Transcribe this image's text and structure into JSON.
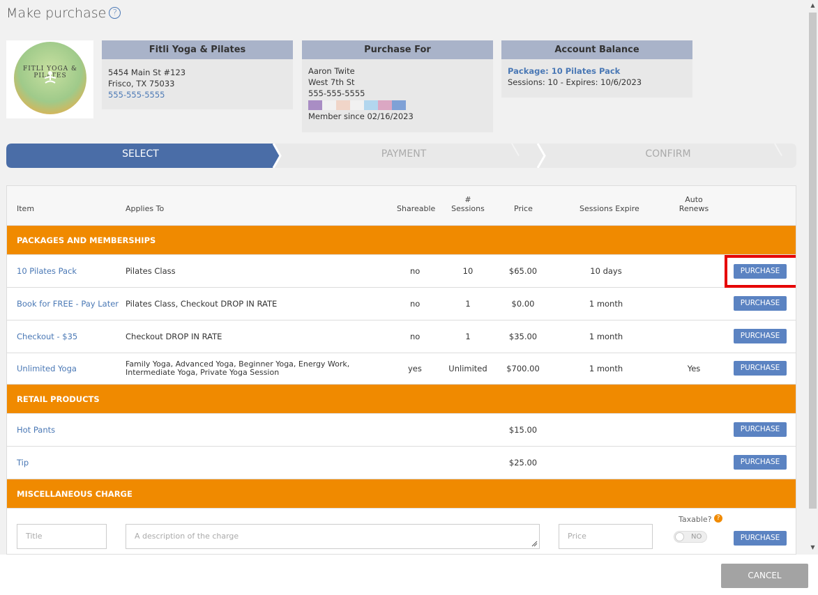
{
  "header": {
    "title": "Make purchase"
  },
  "studio": {
    "name": "Fitli Yoga & Pilates",
    "address1": "5454 Main St #123",
    "address2": "Frisco, TX 75033",
    "phone": "555-555-5555",
    "logo_text": "FITLI YOGA & PILATES"
  },
  "purchase_for": {
    "heading": "Purchase For",
    "name": "Aaron Twite",
    "street": "West 7th St",
    "phone": "555-555-5555",
    "member_since": "Member since 02/16/2023",
    "swatches": [
      "#a98dc4",
      "#f1f1f1",
      "#f0d5c8",
      "#f1f1f1",
      "#b2d6ee",
      "#dba7c3",
      "#7fa1d6"
    ]
  },
  "account_balance": {
    "heading": "Account Balance",
    "package": "Package: 10 Pilates Pack",
    "details": "Sessions: 10 -  Expires: 10/6/2023"
  },
  "steps": [
    "SELECT",
    "PAYMENT",
    "CONFIRM"
  ],
  "table": {
    "headers": {
      "item": "Item",
      "applies_to": "Applies To",
      "shareable": "Shareable",
      "sessions_top": "#",
      "sessions_bottom": "Sessions",
      "price": "Price",
      "expire": "Sessions Expire",
      "auto_top": "Auto",
      "auto_bottom": "Renews"
    },
    "sections": {
      "packages": "PACKAGES AND MEMBERSHIPS",
      "retail": "RETAIL PRODUCTS",
      "misc": "MISCELLANEOUS CHARGE"
    },
    "packages": [
      {
        "item": "10 Pilates Pack",
        "applies": "Pilates Class",
        "shareable": "no",
        "sessions": "10",
        "price": "$65.00",
        "expire": "10 days",
        "auto": ""
      },
      {
        "item": "Book for FREE - Pay Later",
        "applies": "Pilates Class, Checkout DROP IN RATE",
        "shareable": "no",
        "sessions": "1",
        "price": "$0.00",
        "expire": "1 month",
        "auto": ""
      },
      {
        "item": "Checkout - $35",
        "applies": "Checkout DROP IN RATE",
        "shareable": "no",
        "sessions": "1",
        "price": "$35.00",
        "expire": "1 month",
        "auto": ""
      },
      {
        "item": "Unlimited Yoga",
        "applies": "Family Yoga, Advanced Yoga, Beginner Yoga, Energy Work, Intermediate Yoga, Private Yoga Session",
        "shareable": "yes",
        "sessions": "Unlimited",
        "price": "$700.00",
        "expire": "1 month",
        "auto": "Yes"
      }
    ],
    "retail": [
      {
        "item": "Hot Pants",
        "price": "$15.00"
      },
      {
        "item": "Tip",
        "price": "$25.00"
      }
    ],
    "purchase_label": "PURCHASE",
    "misc": {
      "title_placeholder": "Title",
      "desc_placeholder": "A description of the charge",
      "price_placeholder": "Price",
      "taxable_label": "Taxable?",
      "toggle_label": "NO"
    }
  },
  "footer": {
    "cancel_label": "CANCEL"
  },
  "colors": {
    "accent": "#5b83c2",
    "section": "#f08a00",
    "step_active": "#4a6da7",
    "highlight": "#e60000"
  }
}
